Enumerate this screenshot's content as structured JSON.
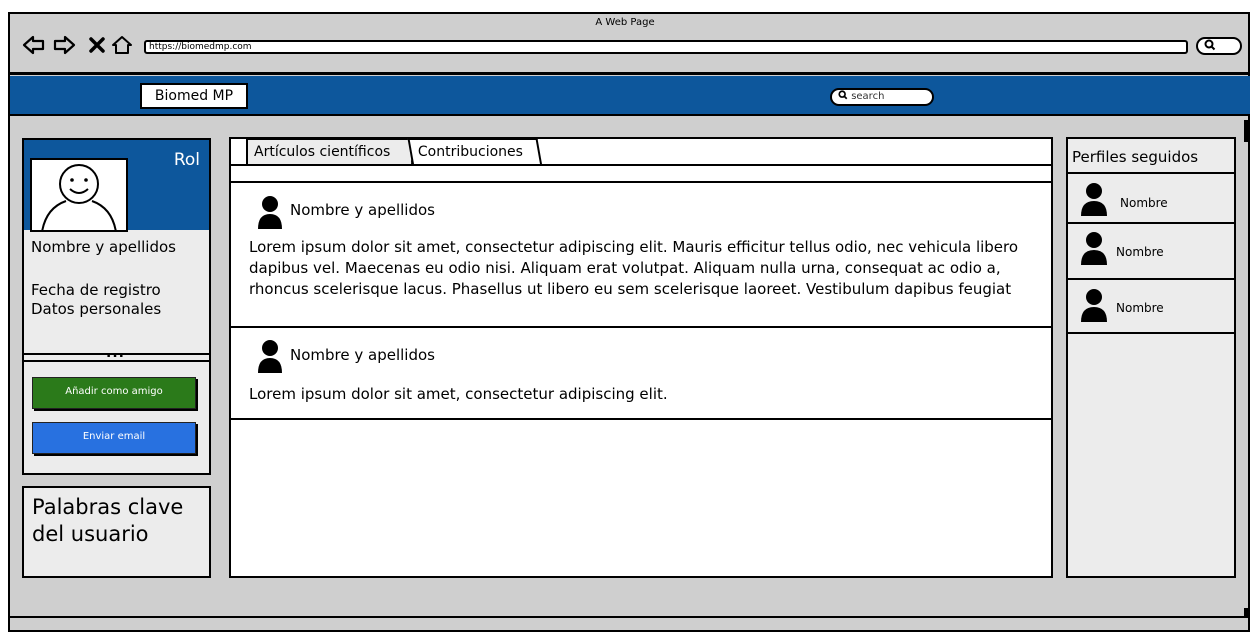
{
  "window": {
    "title": "A Web Page"
  },
  "browser": {
    "nav_icons": [
      "back-arrow-icon",
      "forward-arrow-icon",
      "close-icon",
      "home-icon"
    ],
    "url": "https://biomedmp.com",
    "search_icon": "search-icon"
  },
  "header": {
    "brand": "Biomed MP",
    "search_placeholder": "search",
    "color": "#0d579c"
  },
  "profile": {
    "role": "Rol",
    "name": "Nombre y apellidos",
    "registration": "Fecha de registro",
    "personal_data": "Datos personales",
    "more": "...",
    "add_friend": "Añadir como amigo",
    "send_email": "Enviar email",
    "keywords": "Palabras clave del usuario",
    "add_friend_color": "#2b7a1a",
    "send_email_color": "#2871e0"
  },
  "feed": {
    "tabs": [
      {
        "label": "Artículos científicos"
      },
      {
        "label": "Contribuciones"
      }
    ],
    "posts": [
      {
        "author": "Nombre y apellidos",
        "body": "Lorem ipsum dolor sit amet, consectetur adipiscing elit. Mauris efficitur tellus odio, nec vehicula libero dapibus vel. Maecenas eu odio nisi. Aliquam erat volutpat. Aliquam nulla urna, consequat ac odio a, rhoncus scelerisque lacus. Phasellus ut libero eu sem scelerisque laoreet. Vestibulum dapibus feugiat"
      },
      {
        "author": "Nombre y apellidos",
        "body": "Lorem ipsum dolor sit amet, consectetur adipiscing elit."
      }
    ]
  },
  "following": {
    "title": "Perfiles seguidos",
    "items": [
      {
        "name": "Nombre"
      },
      {
        "name": "Nombre"
      },
      {
        "name": "Nombre"
      }
    ]
  }
}
